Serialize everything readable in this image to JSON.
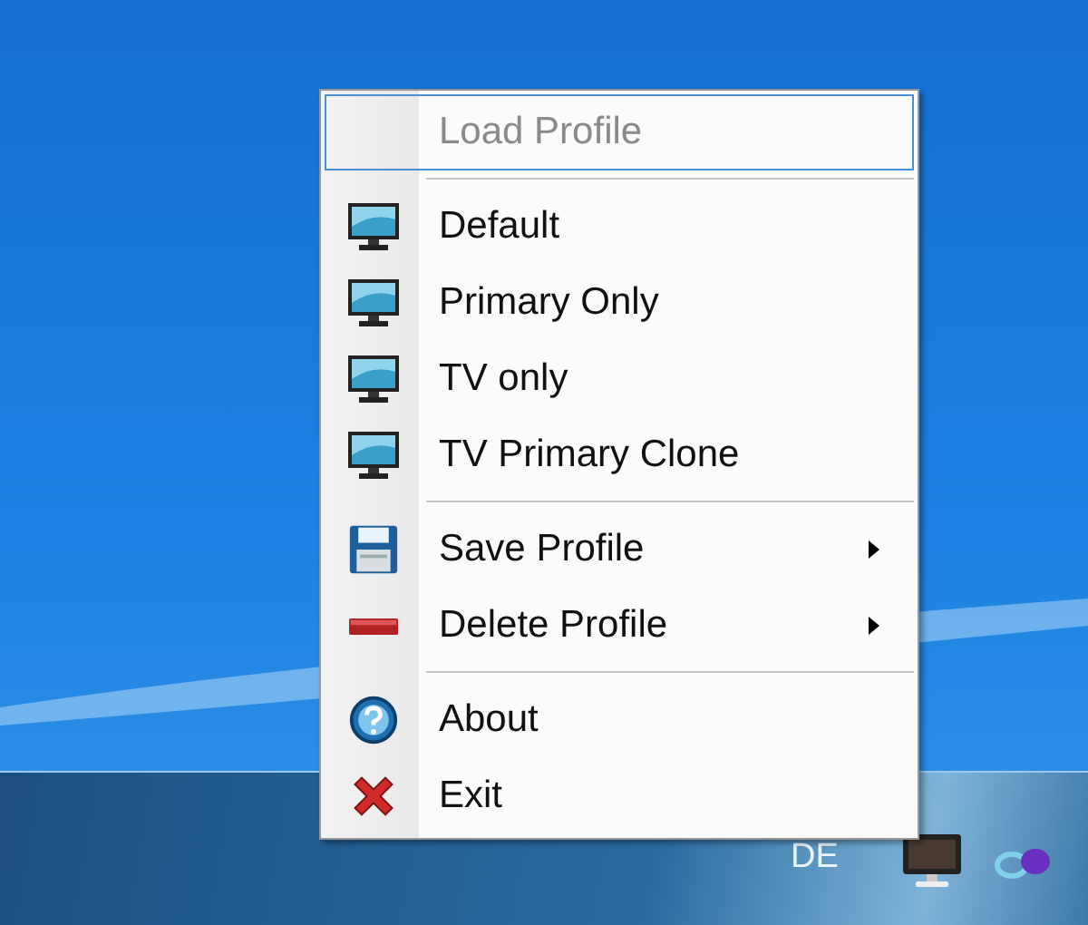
{
  "menu": {
    "items": [
      {
        "kind": "plain",
        "label": "Load Profile",
        "disabled": true,
        "selected": true,
        "submenu": false
      },
      {
        "kind": "separator"
      },
      {
        "kind": "monitor",
        "label": "Default",
        "disabled": false,
        "selected": false,
        "submenu": false
      },
      {
        "kind": "monitor",
        "label": "Primary Only",
        "disabled": false,
        "selected": false,
        "submenu": false
      },
      {
        "kind": "monitor",
        "label": "TV only",
        "disabled": false,
        "selected": false,
        "submenu": false
      },
      {
        "kind": "monitor",
        "label": "TV Primary Clone",
        "disabled": false,
        "selected": false,
        "submenu": false
      },
      {
        "kind": "separator"
      },
      {
        "kind": "save",
        "label": "Save Profile",
        "disabled": false,
        "selected": false,
        "submenu": true
      },
      {
        "kind": "delete",
        "label": "Delete Profile",
        "disabled": false,
        "selected": false,
        "submenu": true
      },
      {
        "kind": "separator"
      },
      {
        "kind": "about",
        "label": "About",
        "disabled": false,
        "selected": false,
        "submenu": false
      },
      {
        "kind": "exit",
        "label": "Exit",
        "disabled": false,
        "selected": false,
        "submenu": false
      }
    ]
  },
  "taskbar": {
    "language": "DE"
  }
}
